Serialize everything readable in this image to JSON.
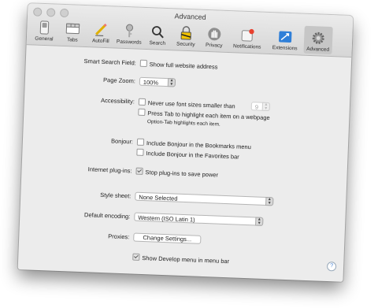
{
  "window": {
    "title": "Advanced"
  },
  "toolbar": {
    "items": [
      {
        "label": "General",
        "icon": "switch-icon"
      },
      {
        "label": "Tabs",
        "icon": "tabs-icon"
      },
      {
        "label": "AutoFill",
        "icon": "pencil-icon"
      },
      {
        "label": "Passwords",
        "icon": "key-icon"
      },
      {
        "label": "Search",
        "icon": "search-icon"
      },
      {
        "label": "Security",
        "icon": "lock-icon"
      },
      {
        "label": "Privacy",
        "icon": "hand-icon"
      },
      {
        "label": "Notifications",
        "icon": "bell-icon"
      },
      {
        "label": "Extensions",
        "icon": "puzzle-icon"
      },
      {
        "label": "Advanced",
        "icon": "gear-icon"
      }
    ],
    "selected": "Advanced"
  },
  "settings": {
    "smart_search": {
      "label": "Smart Search Field:",
      "checkbox": "Show full website address",
      "checked": false
    },
    "page_zoom": {
      "label": "Page Zoom:",
      "value": "100%"
    },
    "accessibility": {
      "label": "Accessibility:",
      "font_size_checkbox": "Never use font sizes smaller than",
      "font_size_value": "9",
      "font_size_checked": false,
      "tab_checkbox": "Press Tab to highlight each item on a webpage",
      "tab_checked": false,
      "tab_note": "Option-Tab highlights each item."
    },
    "bonjour": {
      "label": "Bonjour:",
      "bookmarks_checkbox": "Include Bonjour in the Bookmarks menu",
      "favorites_checkbox": "Include Bonjour in the Favorites bar"
    },
    "plugins": {
      "label": "Internet plug-ins:",
      "checkbox": "Stop plug-ins to save power",
      "checked": true
    },
    "style_sheet": {
      "label": "Style sheet:",
      "value": "None Selected"
    },
    "encoding": {
      "label": "Default encoding:",
      "value": "Western (ISO Latin 1)"
    },
    "proxies": {
      "label": "Proxies:",
      "button": "Change Settings..."
    },
    "develop": {
      "checkbox": "Show Develop menu in menu bar",
      "checked": true
    },
    "help": "?"
  },
  "colors": {
    "selected_tab_bg": "#c6c6c6",
    "window_bg": "#ececec",
    "notification_dot": "#e8412f",
    "extensions_blue": "#2f7fd8"
  }
}
